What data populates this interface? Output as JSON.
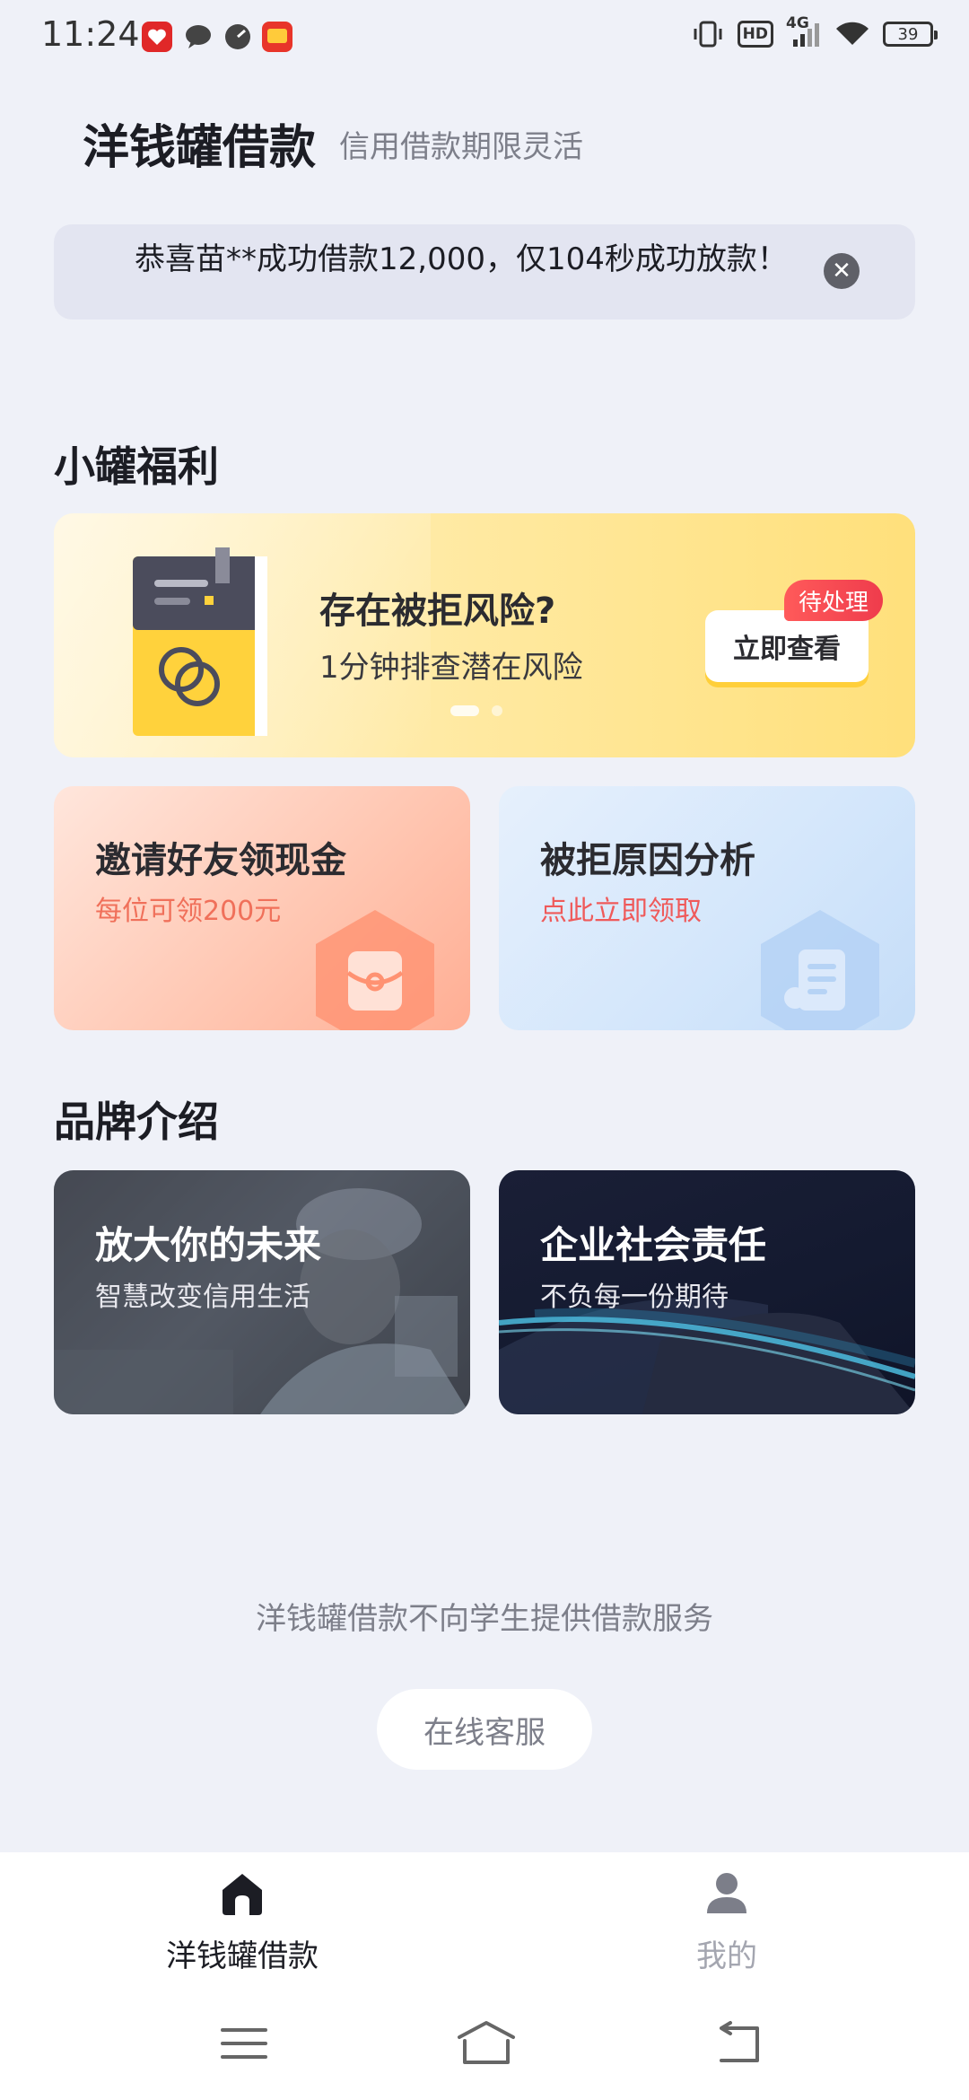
{
  "status_bar": {
    "time": "11:24",
    "network": "4G",
    "hd_label": "HD",
    "battery": "39",
    "notification_icons": [
      "app-red-heart-icon",
      "chat-bubble-icon",
      "speedometer-icon",
      "app-red-badge-icon"
    ],
    "right_icons": [
      "vibrate-icon",
      "hd-icon",
      "cell-signal-icon",
      "wifi-icon",
      "battery-icon"
    ]
  },
  "header": {
    "title": "洋钱罐借款",
    "subtitle": "信用借款期限灵活"
  },
  "notice": {
    "text": "恭喜苗**成功借款12,000，仅104秒成功放款！",
    "close_icon": "close-icon"
  },
  "benefits": {
    "section_title": "小罐福利",
    "banner": {
      "headline": "存在被拒风险?",
      "subline": "1分钟排查潜在风险",
      "cta": "立即查看",
      "badge": "待处理",
      "illustration": "notebook-icon",
      "page_count": 2,
      "active_page": 1
    },
    "cards": [
      {
        "title": "邀请好友领现金",
        "subtitle": "每位可领200元",
        "icon": "red-envelope-icon"
      },
      {
        "title": "被拒原因分析",
        "subtitle": "点此立即领取",
        "icon": "document-icon"
      }
    ]
  },
  "brand": {
    "section_title": "品牌介绍",
    "cards": [
      {
        "title": "放大你的未来",
        "subtitle": "智慧改变信用生活"
      },
      {
        "title": "企业社会责任",
        "subtitle": "不负每一份期待"
      }
    ]
  },
  "footer": {
    "disclaimer": "洋钱罐借款不向学生提供借款服务",
    "service_button": "在线客服"
  },
  "tab_bar": {
    "tabs": [
      {
        "label": "洋钱罐借款",
        "icon": "home-icon",
        "active": true
      },
      {
        "label": "我的",
        "icon": "user-icon",
        "active": false
      }
    ]
  },
  "colors": {
    "background": "#eff1f8",
    "primary_text": "#1c1d24",
    "secondary_text": "#7d7f8a",
    "accent_red": "#ef3c4c",
    "banner_yellow": "#ffe07b"
  }
}
